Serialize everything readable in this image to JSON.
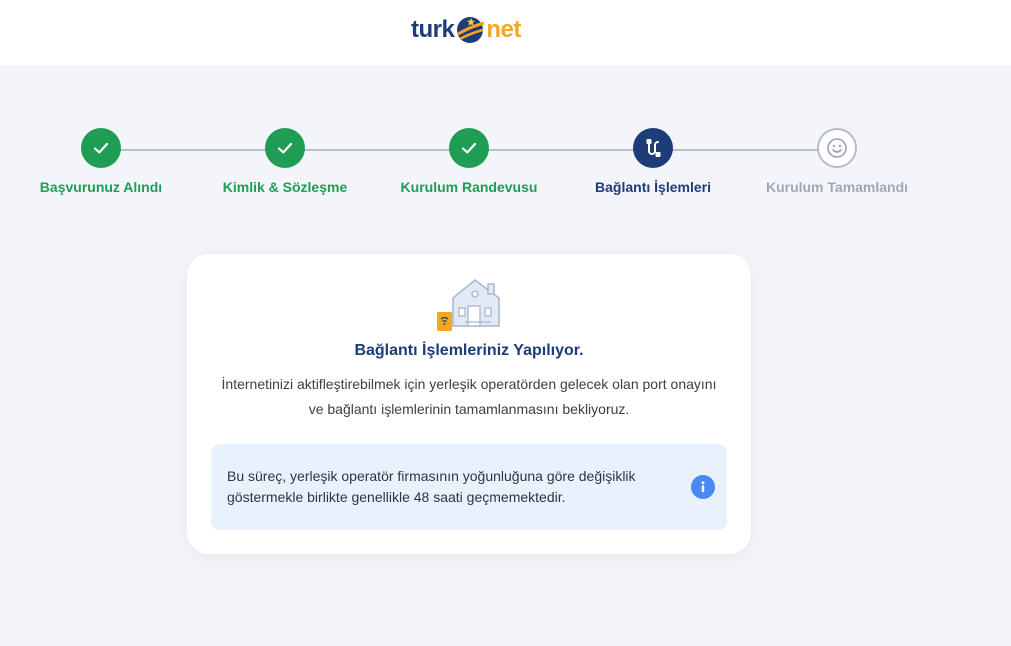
{
  "header": {
    "logo_left": "turk",
    "logo_right": "net"
  },
  "stepper": {
    "steps": [
      {
        "label": "Başvurunuz Alındı",
        "status": "done",
        "icon": "check-icon"
      },
      {
        "label": "Kimlik & Sözleşme",
        "status": "done",
        "icon": "check-icon"
      },
      {
        "label": "Kurulum Randevusu",
        "status": "done",
        "icon": "check-icon"
      },
      {
        "label": "Bağlantı İşlemleri",
        "status": "active",
        "icon": "connection-icon"
      },
      {
        "label": "Kurulum Tamamlandı",
        "status": "pending",
        "icon": "smiley-icon"
      }
    ]
  },
  "card": {
    "icon": "house-modem-icon",
    "title": "Bağlantı İşlemleriniz Yapılıyor.",
    "description": "İnternetinizi aktifleştirebilmek için yerleşik operatörden gelecek olan port onayını ve bağlantı işlemlerinin tamamlanmasını bekliyoruz.",
    "info_text": "Bu süreç, yerleşik operatör firmasının yoğunluğuna göre değişiklik göstermekle birlikte genellikle 48 saati geçmemektedir.",
    "info_icon": "info-icon"
  },
  "colors": {
    "done": "#1f9d55",
    "active": "#1d3c78",
    "pending": "#a0a7b3",
    "accent_orange": "#f5a623",
    "info_bg": "#e9f1fd",
    "info_icon": "#4a8af0"
  }
}
